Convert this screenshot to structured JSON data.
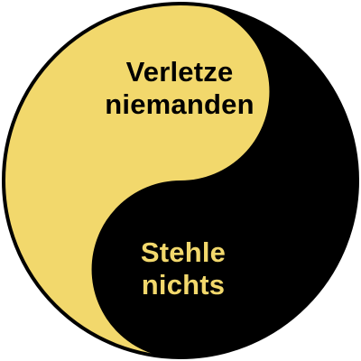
{
  "colors": {
    "yellow": "#f2d86c",
    "black": "#000000",
    "outline": "#000000",
    "background": "#ffffff"
  },
  "top_text": {
    "line1": "Verletze",
    "line2": "niemanden",
    "color": "#000000"
  },
  "bottom_text": {
    "line1": "Stehle",
    "line2": "nichts",
    "color": "#f2d86c"
  }
}
